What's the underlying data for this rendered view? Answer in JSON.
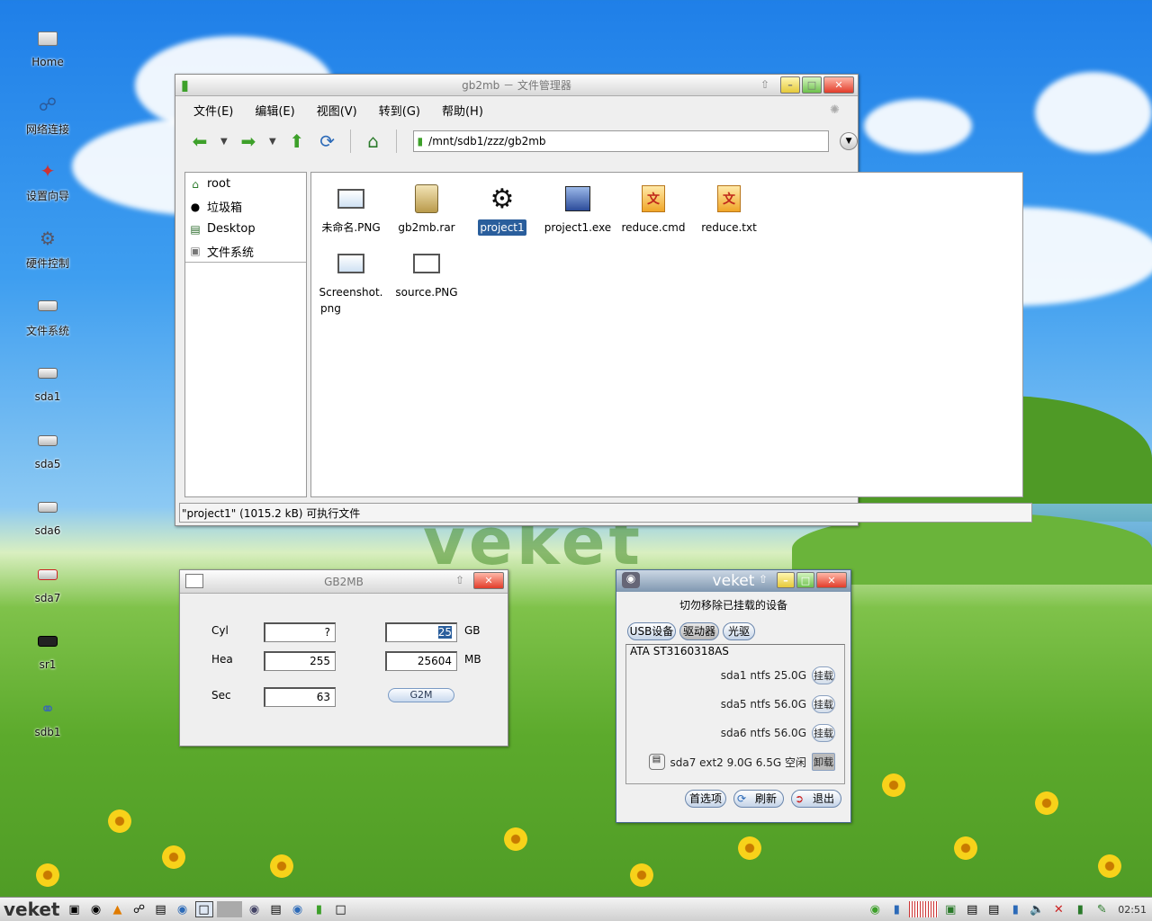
{
  "desktop": {
    "watermark": "veket",
    "icons": [
      {
        "label": "Home",
        "icon": "home-folder-icon"
      },
      {
        "label": "网络连接",
        "icon": "network-icon"
      },
      {
        "label": "设置向导",
        "icon": "wizard-icon"
      },
      {
        "label": "硬件控制",
        "icon": "hardware-icon"
      },
      {
        "label": "文件系统",
        "icon": "filesystem-icon"
      },
      {
        "label": "sda1",
        "icon": "drive-icon"
      },
      {
        "label": "sda5",
        "icon": "drive-icon"
      },
      {
        "label": "sda6",
        "icon": "drive-icon"
      },
      {
        "label": "sda7",
        "icon": "drive-mounted-icon"
      },
      {
        "label": "sr1",
        "icon": "optical-drive-icon"
      },
      {
        "label": "sdb1",
        "icon": "usb-drive-icon"
      }
    ]
  },
  "file_manager": {
    "title": "gb2mb － 文件管理器",
    "menu": [
      "文件(E)",
      "编辑(E)",
      "视图(V)",
      "转到(G)",
      "帮助(H)"
    ],
    "address": "/mnt/sdb1/zzz/gb2mb",
    "sidebar": [
      "root",
      "垃圾箱",
      "Desktop",
      "文件系统"
    ],
    "files": [
      {
        "name": "未命名.PNG",
        "kind": "image"
      },
      {
        "name": "gb2mb.rar",
        "kind": "archive"
      },
      {
        "name": "project1",
        "kind": "executable",
        "selected": true
      },
      {
        "name": "project1.exe",
        "kind": "exe"
      },
      {
        "name": "reduce.cmd",
        "kind": "document"
      },
      {
        "name": "reduce.txt",
        "kind": "document"
      },
      {
        "name": "Screenshot.",
        "name2": "png",
        "kind": "image"
      },
      {
        "name": "source.PNG",
        "kind": "image"
      }
    ],
    "status": "\"project1\" (1015.2 kB) 可执行文件"
  },
  "gb2mb": {
    "title": "GB2MB",
    "labels": {
      "cyl": "Cyl",
      "hea": "Hea",
      "sec": "Sec",
      "gb": "GB",
      "mb": "MB"
    },
    "values": {
      "cyl": "?",
      "hea": "255",
      "sec": "63",
      "gb": "25",
      "mb": "25604"
    },
    "button": "G2M"
  },
  "veket": {
    "title": "veket",
    "subtitle": "切勿移除已挂载的设备",
    "tabs": [
      "USB设备",
      "驱动器",
      "光驱"
    ],
    "disk": "ATA  ST3160318AS",
    "partitions": [
      {
        "text": "sda1  ntfs  25.0G",
        "action": "挂载"
      },
      {
        "text": "sda5  ntfs  56.0G",
        "action": "挂载"
      },
      {
        "text": "sda6  ntfs  56.0G",
        "action": "挂载"
      },
      {
        "text": "sda7  ext2  9.0G 6.5G 空闲",
        "action": "卸载"
      }
    ],
    "buttons": [
      "首选项",
      "刷新",
      "退出"
    ]
  },
  "taskbar": {
    "logo": "veket",
    "clock": "02:51"
  },
  "colors": {
    "selection": "#2a5e9c",
    "close": "#e23c2a",
    "accent_green": "#3da02a"
  }
}
